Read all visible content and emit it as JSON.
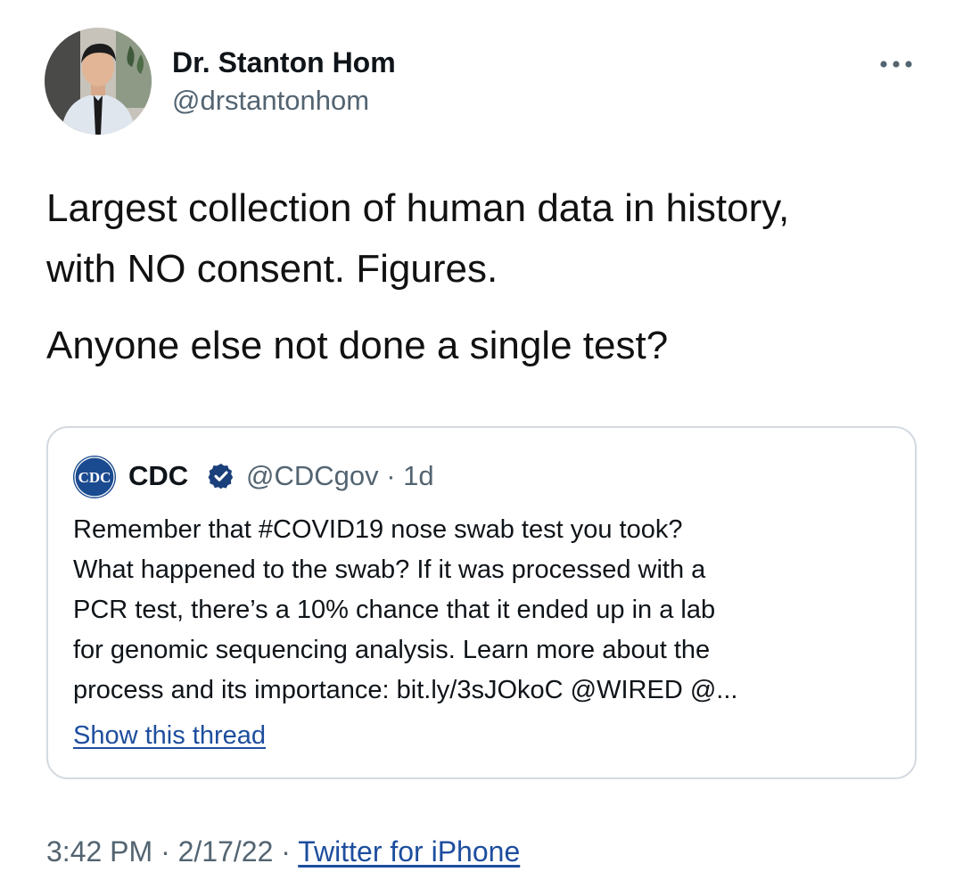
{
  "author": {
    "name": "Dr. Stanton Hom",
    "handle": "@drstantonhom",
    "avatar_icon": "user-photo"
  },
  "more_icon": "more-horizontal-icon",
  "tweet": {
    "lines": [
      "Largest collection of human data in history,",
      "with NO consent. Figures.",
      "Anyone else not done a single test?"
    ]
  },
  "quoted_tweet": {
    "logo_text": "CDC",
    "name": "CDC",
    "handle_time": "@CDCgov · 1d",
    "verified_icon": "verified-badge-icon",
    "body_lines": [
      "Remember that #COVID19 nose swab test you took?",
      "What happened to the swab? If it was processed with a",
      "PCR test, there’s a 10% chance that it ended up in a lab",
      "for genomic sequencing analysis. Learn more about the",
      "process and its importance: bit.ly/3sJOkoC @WIRED @..."
    ],
    "show_thread": "Show this thread"
  },
  "meta": {
    "time": "3:42 PM",
    "separator1": " · ",
    "date": "2/17/22",
    "separator2": " · ",
    "source": "Twitter for iPhone"
  },
  "colors": {
    "verified": "#1d9bf0",
    "link": "#1d4e9e",
    "cdc_blue": "#1a4a8f",
    "muted": "#536471",
    "border": "#d4dae0"
  }
}
